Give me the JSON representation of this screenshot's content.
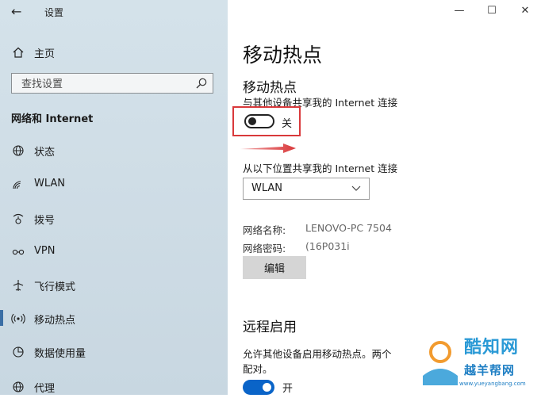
{
  "window": {
    "app_title": "设置",
    "controls": {
      "minimize": "—",
      "maximize": "☐",
      "close": "✕"
    }
  },
  "sidebar": {
    "home_label": "主页",
    "search_placeholder": "查找设置",
    "section_title": "网络和 Internet",
    "items": [
      {
        "label": "状态",
        "icon": "globe-icon"
      },
      {
        "label": "WLAN",
        "icon": "wifi-icon"
      },
      {
        "label": "拨号",
        "icon": "dialup-icon"
      },
      {
        "label": "VPN",
        "icon": "vpn-icon"
      },
      {
        "label": "飞行模式",
        "icon": "airplane-icon"
      },
      {
        "label": "移动热点",
        "icon": "hotspot-icon",
        "active": true
      },
      {
        "label": "数据使用量",
        "icon": "data-usage-icon"
      },
      {
        "label": "代理",
        "icon": "globe-icon"
      }
    ]
  },
  "main": {
    "page_title": "移动热点",
    "hotspot": {
      "heading": "移动热点",
      "share_caption": "与其他设备共享我的 Internet 连接",
      "toggle_state": "关",
      "toggle_on": false
    },
    "share_from": {
      "caption": "从以下位置共享我的 Internet 连接",
      "selected": "WLAN"
    },
    "network_name_label": "网络名称:",
    "network_name_value": "LENOVO-PC 7504",
    "network_password_label": "网络密码:",
    "network_password_value": "(16P031i",
    "edit_button": "编辑",
    "remote": {
      "heading": "远程启用",
      "caption_line1": "允许其他设备启用移动热点。两个",
      "caption_line2": "配对。",
      "toggle_state": "开",
      "toggle_on": true
    }
  },
  "watermark": {
    "main": "酷知网",
    "sub": "越羊帮网",
    "url": "www.yueyangbang.com"
  },
  "colors": {
    "accent": "#0a64c8",
    "highlight_frame": "#d9393b",
    "sidebar_bg": "#cfdde6"
  }
}
